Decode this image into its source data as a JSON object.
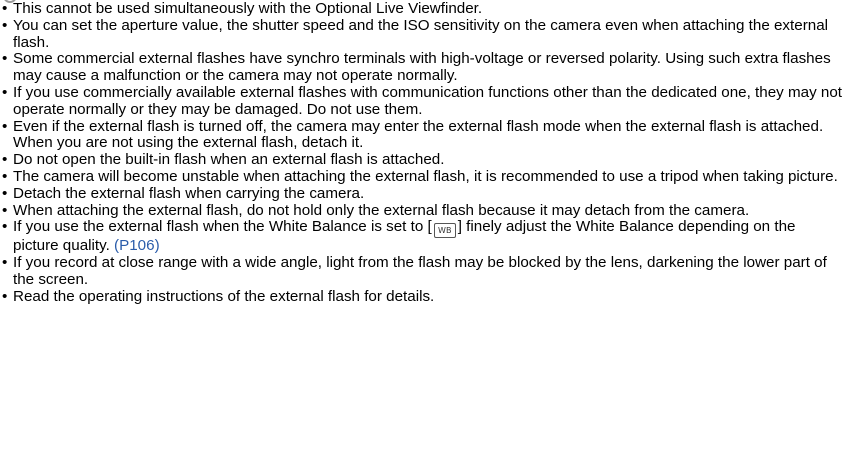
{
  "notes": [
    {
      "text": "This cannot be used simultaneously with the Optional Live Viewfinder."
    },
    {
      "text": "You can set the aperture value, the shutter speed and the ISO sensitivity on the camera even when attaching the external flash."
    },
    {
      "text": "Some commercial external flashes have synchro terminals with high-voltage or reversed polarity. Using such extra flashes may cause a malfunction or the camera may not operate normally."
    },
    {
      "text": "If you use commercially available external flashes with communication functions other than the dedicated one, they may not operate normally or they may be damaged. Do not use them."
    },
    {
      "text": "Even if the external flash is turned off, the camera may enter the external flash mode when the external flash is attached. When you are not using the external flash, detach it."
    },
    {
      "text": "Do not open the built-in flash when an external flash is attached."
    },
    {
      "text": "The camera will become unstable when attaching the external flash, it is recommended to use a tripod when taking picture."
    },
    {
      "text": "Detach the external flash when carrying the camera."
    },
    {
      "text": "When attaching the external flash, do not hold only the external flash because it may detach from the camera."
    },
    {
      "text_before": "If you use the external flash when the White Balance is set to [",
      "icon": "flash-white-balance-icon",
      "icon_label": "WB",
      "text_after": "] finely adjust the White Balance depending on the picture quality.",
      "link": "(P106)",
      "link_color": "#2a5caa"
    },
    {
      "text": "If you record at close range with a wide angle, light from the flash may be blocked by the lens, darkening the lower part of the screen."
    },
    {
      "text": "Read the operating instructions of the external flash for details."
    }
  ]
}
